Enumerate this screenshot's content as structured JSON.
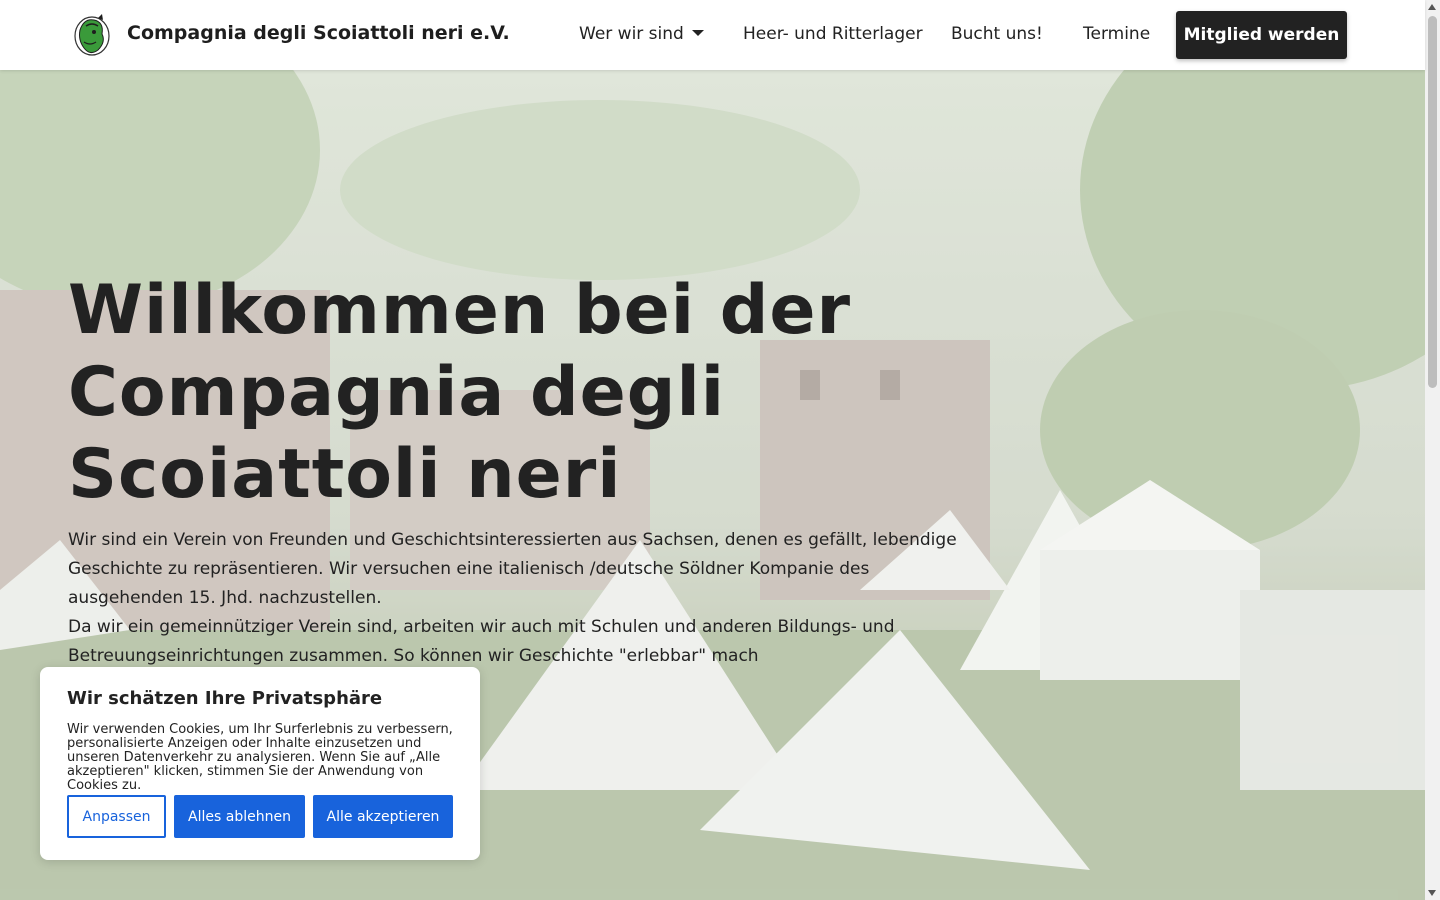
{
  "header": {
    "brand": "Compagnia degli Scoiattoli neri e.V.",
    "nav": [
      {
        "label": "Wer wir sind",
        "has_dropdown": true
      },
      {
        "label": "Heer- und Ritterlager"
      },
      {
        "label": "Bucht  uns!"
      },
      {
        "label": "Termine"
      }
    ],
    "cta_label": "Mitglied werden"
  },
  "hero": {
    "title": "Willkommen bei der Compagnia degli Scoiattoli neri",
    "paragraph_1": "Wir sind ein Verein von Freunden und Geschichtsinteressierten aus Sachsen, denen es gefällt, lebendige Geschichte zu repräsentieren.  Wir versuchen eine italienisch /deutsche Söldner Kompanie des ausgehenden 15. Jhd. nachzustellen.",
    "paragraph_2": "Da wir ein gemeinnütziger Verein sind, arbeiten wir auch mit Schulen und anderen Bildungs- und Betreuungseinrichtungen zusammen. So können wir Geschichte \"erlebbar\" mach"
  },
  "cookie_banner": {
    "title": "Wir schätzen Ihre Privatsphäre",
    "text": "Wir verwenden Cookies, um Ihr Surferlebnis zu verbessern, personalisierte Anzeigen oder Inhalte einzusetzen und unseren Datenverkehr zu analysieren. Wenn Sie auf „Alle akzeptieren\" klicken, stimmen Sie der Anwendung von Cookies zu.",
    "buttons": {
      "customize": "Anpassen",
      "reject": "Alles ablehnen",
      "accept": "Alle akzeptieren"
    }
  },
  "colors": {
    "cookie_button_blue": "#1863dc",
    "cta_background": "#222222"
  },
  "icons": {
    "logo": "squirrel-logo-icon",
    "dropdown": "caret-down-icon"
  }
}
